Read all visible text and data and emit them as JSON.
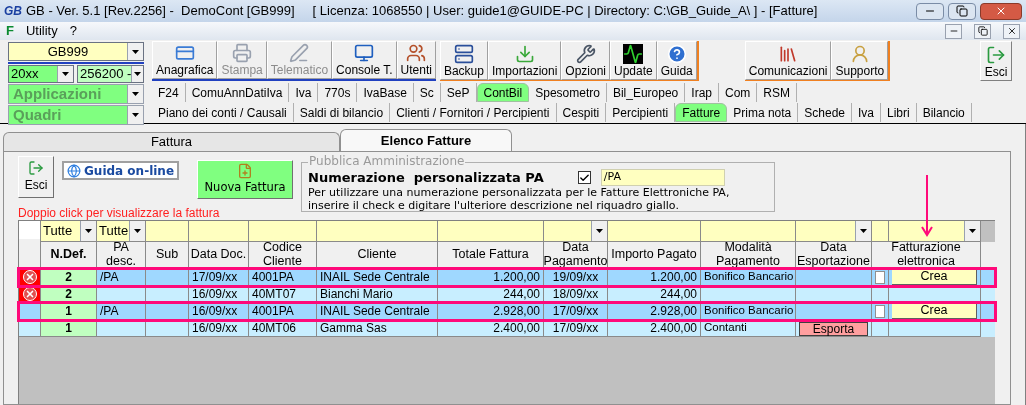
{
  "window": {
    "logo": "GB",
    "title": "GB - Ver. 5.1 [Rev.2256] -  DemoCont [GB999]     [ Licenza: 1068550 | User: guide1@GUIDE-PC | Directory: C:\\GB_Guide_A\\ ] - [Fatture]"
  },
  "menu": {
    "logo": "F",
    "items": [
      "Utility",
      "?"
    ]
  },
  "selectors": {
    "company": "GB999",
    "year": "20xx",
    "code": "256200 -",
    "applications": "Applicazioni",
    "panels": "Quadri"
  },
  "toolbar": [
    {
      "buttons": [
        {
          "label": "Anagrafica",
          "disabled": false
        },
        {
          "label": "Stampa",
          "disabled": true
        },
        {
          "label": "Telematico",
          "disabled": true
        },
        {
          "label": "Console T.",
          "disabled": false
        },
        {
          "label": "Utenti",
          "disabled": false
        }
      ]
    },
    {
      "buttons": [
        {
          "label": "Backup",
          "disabled": false
        },
        {
          "label": "Importazioni",
          "disabled": false
        },
        {
          "label": "Opzioni",
          "disabled": false
        },
        {
          "label": "Update",
          "disabled": false
        },
        {
          "label": "Guida",
          "disabled": false
        }
      ]
    },
    {
      "buttons": [
        {
          "label": "Comunicazioni",
          "disabled": false
        },
        {
          "label": "Supporto",
          "disabled": false
        }
      ]
    }
  ],
  "exit_button": "Esci",
  "module_tabs": [
    {
      "label": "F24",
      "selected": false
    },
    {
      "label": "ComuAnnDatiIva",
      "selected": false
    },
    {
      "label": "Iva",
      "selected": false
    },
    {
      "label": "770s",
      "selected": false
    },
    {
      "label": "IvaBase",
      "selected": false
    },
    {
      "label": "Sc",
      "selected": false
    },
    {
      "label": "SeP",
      "selected": false
    },
    {
      "label": "ContBil",
      "selected": true
    },
    {
      "label": "Spesometro",
      "selected": false
    },
    {
      "label": "Bil_Europeo",
      "selected": false
    },
    {
      "label": "Irap",
      "selected": false
    },
    {
      "label": "Com",
      "selected": false
    },
    {
      "label": "RSM",
      "selected": false
    }
  ],
  "section_tabs": [
    {
      "label": "Piano dei conti / Causali",
      "selected": false
    },
    {
      "label": "Saldi di bilancio",
      "selected": false
    },
    {
      "label": "Clienti / Fornitori / Percipienti",
      "selected": false
    },
    {
      "label": "Cespiti",
      "selected": false
    },
    {
      "label": "Percipienti",
      "selected": false
    },
    {
      "label": "Fatture",
      "selected": true
    },
    {
      "label": "Prima nota",
      "selected": false
    },
    {
      "label": "Schede",
      "selected": false
    },
    {
      "label": "Iva",
      "selected": false
    },
    {
      "label": "Libri",
      "selected": false
    },
    {
      "label": "Bilancio",
      "selected": false
    }
  ],
  "page_tabs": [
    {
      "label": "Fattura",
      "selected": false
    },
    {
      "label": "Elenco Fatture",
      "selected": true
    }
  ],
  "actions": {
    "exit": "Esci",
    "help": "Guida on-line",
    "new_invoice": "Nuova Fattura"
  },
  "pa_box": {
    "legend": "Pubblica Amministrazione",
    "title": "Numerazione  personalizzata PA",
    "checked": true,
    "suffix": "/PA",
    "description": [
      "Per utilizzare una numerazione personalizzata per le Fatture Elettroniche PA,",
      "inserire il check e digitare l'ulteriore descrizione nel riquadro giallo."
    ]
  },
  "hint": "Doppio click per visualizzare la fattura",
  "table": {
    "columns": [
      {
        "heading": "N.Def.",
        "filter": {
          "kind": "combo",
          "value": "Tutte"
        }
      },
      {
        "heading": "PA desc.",
        "filter": {
          "kind": "combo",
          "value": "Tutte"
        }
      },
      {
        "heading": "Sub"
      },
      {
        "heading": "Data Doc."
      },
      {
        "heading": "Codice Cliente"
      },
      {
        "heading": "Cliente"
      },
      {
        "heading": "Totale Fattura"
      },
      {
        "heading": "Data Pagamento",
        "filter": {
          "kind": "dropdown"
        }
      },
      {
        "heading": "Importo Pagato"
      },
      {
        "heading": "Modalità Pagamento"
      },
      {
        "heading": "Data Esportazione",
        "filter": {
          "kind": "dropdown"
        }
      },
      {
        "heading": "Fatturazione elettronica",
        "filter": {
          "kind": "dropdown"
        }
      }
    ],
    "rows": [
      {
        "error": true,
        "selected": true,
        "marked": true,
        "n_def": "2",
        "pa_desc": "/PA",
        "data_doc": "17/09/xx",
        "codice_cliente": "4001PA",
        "cliente": "INAIL Sede Centrale",
        "totale": "1.200,00",
        "data_pagamento": "19/09/xx",
        "importo_pagato": "1.200,00",
        "modalita": "Bonifico Bancario",
        "invoice_checkbox": {
          "checked": false
        },
        "einvoice_button": "Crea"
      },
      {
        "error": true,
        "selected": false,
        "marked": false,
        "n_def": "2",
        "data_doc": "16/09/xx",
        "codice_cliente": "40MT07",
        "cliente": "Bianchi Mario",
        "totale": "244,00",
        "data_pagamento": "18/09/xx",
        "importo_pagato": "244,00"
      },
      {
        "error": false,
        "selected": true,
        "marked": true,
        "n_def": "1",
        "pa_desc": "/PA",
        "data_doc": "16/09/xx",
        "codice_cliente": "4001PA",
        "cliente": "INAIL Sede Centrale",
        "totale": "2.928,00",
        "data_pagamento": "17/09/xx",
        "importo_pagato": "2.928,00",
        "modalita": "Bonifico Bancario",
        "invoice_checkbox": {
          "checked": false
        },
        "einvoice_button": "Crea"
      },
      {
        "error": false,
        "selected": false,
        "marked": false,
        "n_def": "1",
        "data_doc": "16/09/xx",
        "codice_cliente": "40MT06",
        "cliente": "Gamma Sas",
        "totale": "2.400,00",
        "data_pagamento": "17/09/xx",
        "importo_pagato": "2.400,00",
        "modalita": "Contanti",
        "export_button": "Esporta"
      }
    ]
  }
}
